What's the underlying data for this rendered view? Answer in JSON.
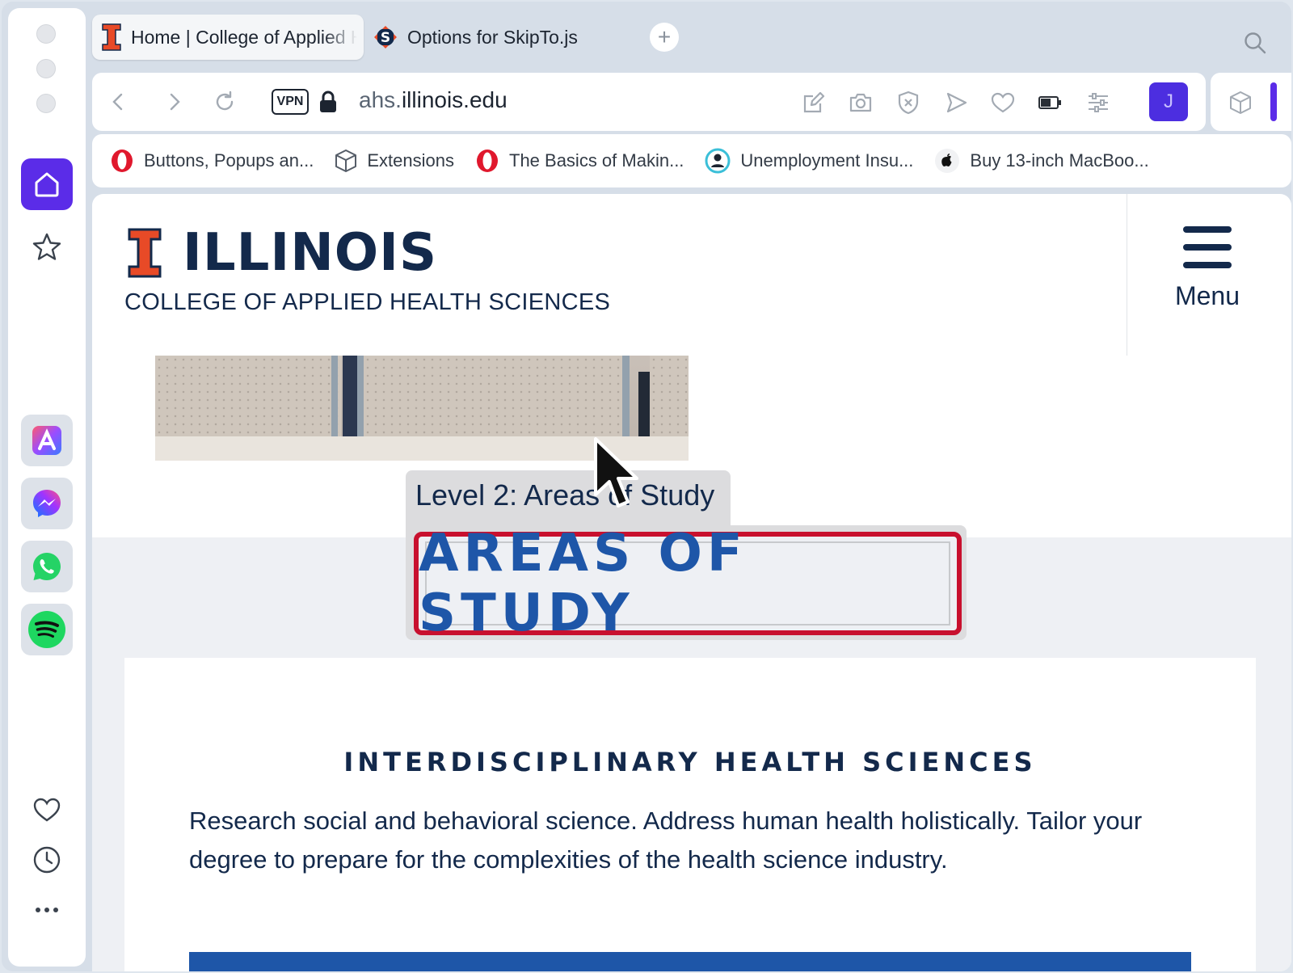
{
  "tabs": [
    {
      "title": "Home | College of Applied Health Sciences",
      "active": true
    },
    {
      "title": "Options for SkipTo.js",
      "active": false
    }
  ],
  "address": {
    "vpn_label": "VPN",
    "url_domain_prefix": "ahs.",
    "url_domain_main": "illinois.edu"
  },
  "profile_initial": "J",
  "bookmarks": [
    {
      "label": "Buttons, Popups an...",
      "icon": "opera-icon"
    },
    {
      "label": "Extensions",
      "icon": "cube-icon"
    },
    {
      "label": "The Basics of Makin...",
      "icon": "opera-icon"
    },
    {
      "label": "Unemployment Insu...",
      "icon": "person-icon"
    },
    {
      "label": "Buy 13-inch MacBoo...",
      "icon": "apple-icon"
    }
  ],
  "page": {
    "wordmark": "ILLINOIS",
    "college": "COLLEGE OF APPLIED HEALTH SCIENCES",
    "menu_label": "Menu",
    "skipto_tooltip": "Level 2: Areas of Study",
    "section_title": "AREAS OF STUDY",
    "card_heading": "INTERDISCIPLINARY HEALTH SCIENCES",
    "card_body": "Research social and behavioral science. Address human health holistically. Tailor your degree to prepare for the complexities of the health science industry."
  },
  "colors": {
    "illinois_orange": "#e84a27",
    "illinois_blue": "#13294b",
    "link_blue": "#1e56a8",
    "focus_red": "#c8102e",
    "opera_purple": "#5b2ce8"
  }
}
